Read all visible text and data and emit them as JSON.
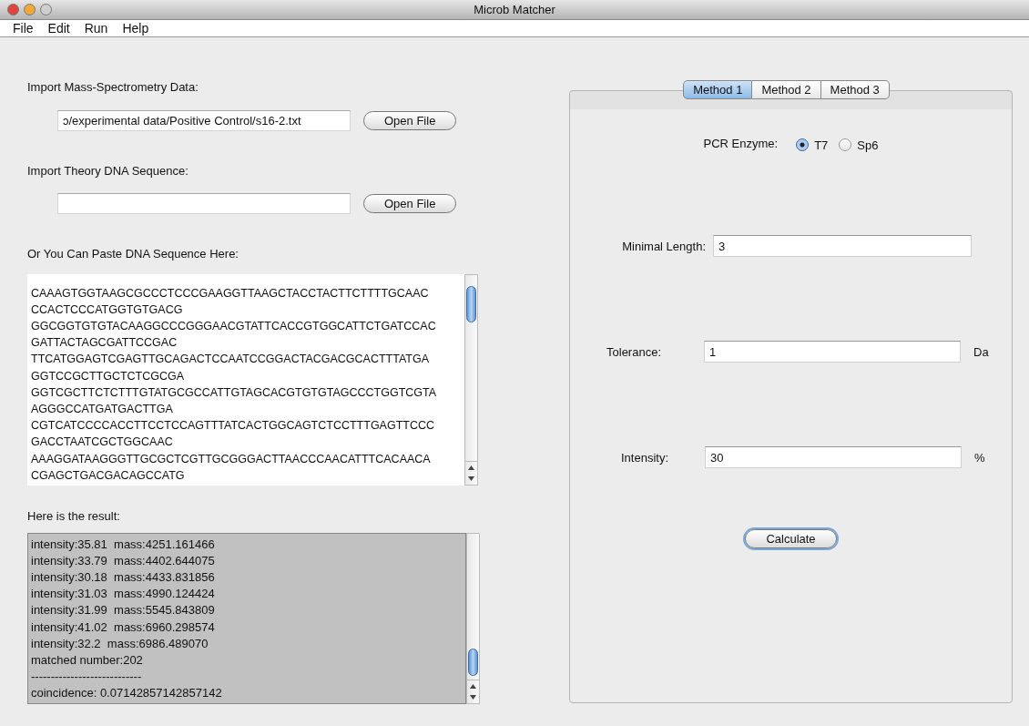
{
  "window": {
    "title": "Microb Matcher"
  },
  "menu": [
    "File",
    "Edit",
    "Run",
    "Help"
  ],
  "left": {
    "mass_spec": {
      "label": "Import Mass-Spectrometry Data:",
      "value": "ɔ/experimental data/Positive Control/s16-2.txt",
      "button": "Open File"
    },
    "theory": {
      "label": "Import Theory DNA Sequence:",
      "button": "Open File"
    },
    "paste": {
      "label": "Or You Can Paste DNA Sequence Here:",
      "lines": [
        "CAAAGTGGTAAGCGCCCTCCCGAAGGTTAAGCTACCTACTTCTTTTGCAAC",
        "CCACTCCCATGGTGTGACG",
        "GGCGGTGTGTACAAGGCCCGGGAACGTATTCACCGTGGCATTCTGATCCAC",
        "GATTACTAGCGATTCCGAC",
        "TTCATGGAGTCGAGTTGCAGACTCCAATCCGGACTACGACGCACTTTATGA",
        "GGTCCGCTTGCTCTCGCGA",
        "GGTCGCTTCTCTTTGTATGCGCCATTGTAGCACGTGTGTAGCCCTGGTCGTA",
        "AGGGCCATGATGACTTGA",
        "CGTCATCCCCACCTTCCTCCAGTTTATCACTGGCAGTCTCCTTTGAGTTCCC",
        "GACCTAATCGCTGGCAAC",
        "AAAGGATAAGGGTTGCGCTCGTTGCGGGACTTAACCCAACATTTCACAACA",
        "CGAGCTGACGACAGCCATG"
      ]
    },
    "result": {
      "label": "Here is the result:",
      "lines": [
        "intensity:35.81  mass:4251.161466",
        "intensity:33.79  mass:4402.644075",
        "intensity:30.18  mass:4433.831856",
        "intensity:31.03  mass:4990.124424",
        "intensity:31.99  mass:5545.843809",
        "intensity:41.02  mass:6960.298574",
        "intensity:32.2  mass:6986.489070",
        "matched number:202",
        "----------------------------",
        "coincidence: 0.07142857142857142"
      ]
    }
  },
  "tabs": [
    {
      "label": "Method 1",
      "selected": true
    },
    {
      "label": "Method 2",
      "selected": false
    },
    {
      "label": "Method 3",
      "selected": false
    }
  ],
  "method": {
    "enzyme": {
      "label": "PCR Enzyme:",
      "options": [
        {
          "label": "T7",
          "selected": true
        },
        {
          "label": "Sp6",
          "selected": false
        }
      ]
    },
    "fields": [
      {
        "label": "Minimal Length:",
        "value": "3"
      },
      {
        "label": "Tolerance:",
        "value": "1",
        "unit": "Da"
      },
      {
        "label": "Intensity:",
        "value": "30",
        "unit": "%"
      }
    ],
    "button": "Calculate"
  }
}
